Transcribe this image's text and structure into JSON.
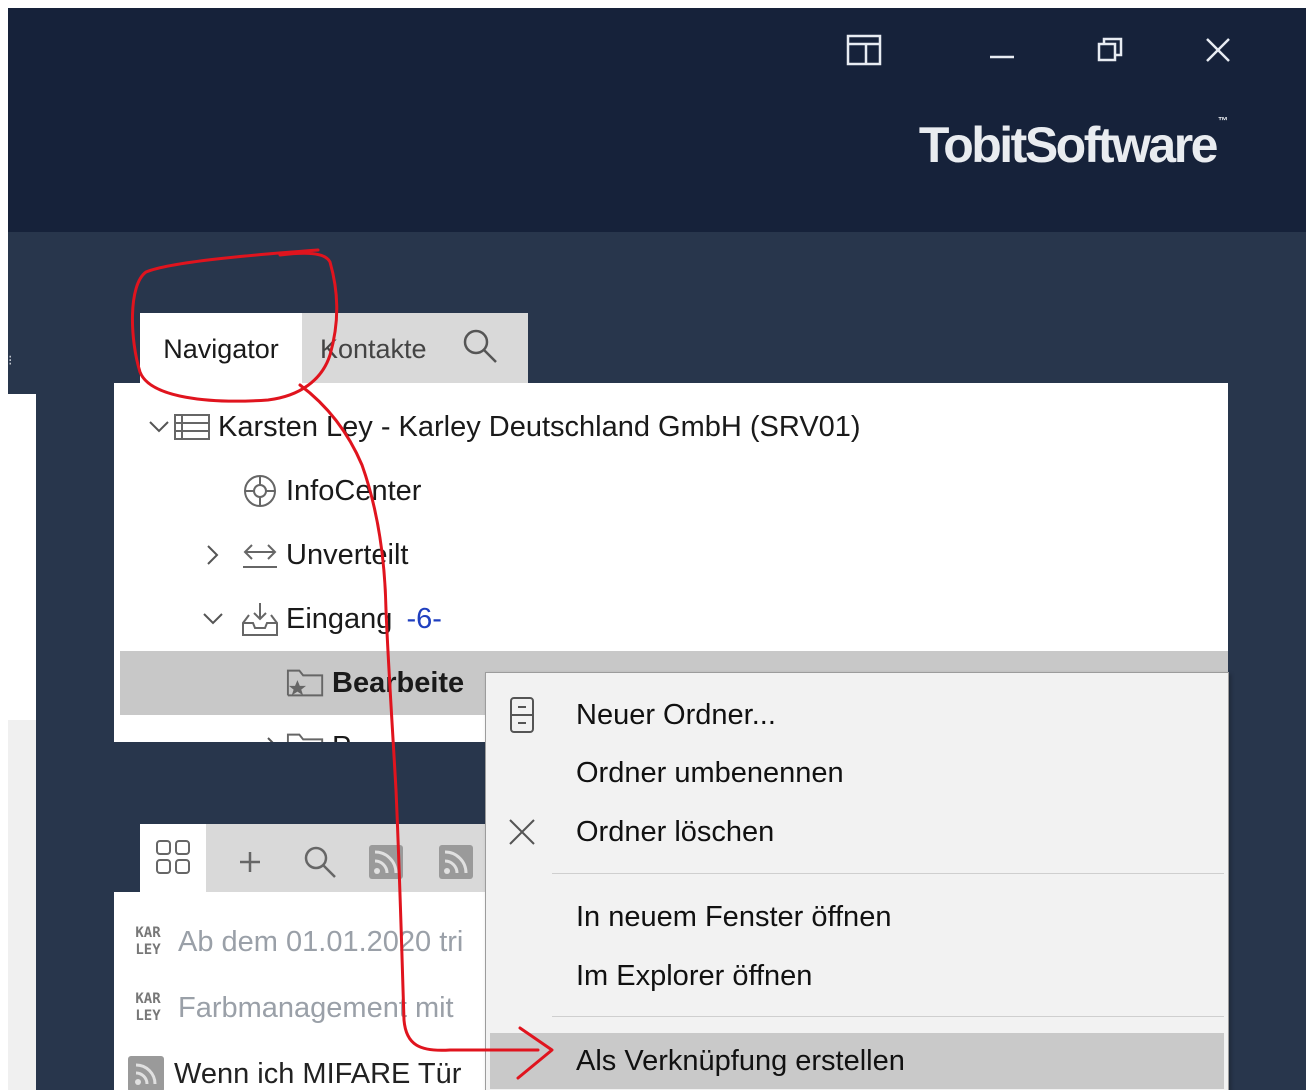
{
  "window": {
    "brand": "TobitSoftware",
    "brand_mark": "™"
  },
  "navigator": {
    "tabs": [
      {
        "label": "Navigator",
        "active": true
      },
      {
        "label": "Kontakte",
        "active": false
      }
    ],
    "tree": [
      {
        "label": "Karsten Ley - Karley Deutschland GmbH (SRV01)",
        "icon": "server-icon",
        "expanded": true
      },
      {
        "label": "InfoCenter",
        "icon": "infocenter-icon"
      },
      {
        "label": "Unverteilt",
        "icon": "unassigned-icon",
        "expanded": false
      },
      {
        "label": "Eingang",
        "icon": "inbox-icon",
        "expanded": true,
        "count": "-6-"
      },
      {
        "label": "Bearbeite",
        "icon": "folder-star-icon",
        "selected": true
      },
      {
        "label": "P",
        "icon": "folder-icon"
      }
    ]
  },
  "feed": {
    "items": [
      {
        "badge": [
          "KAR",
          "LEY"
        ],
        "text": "Ab dem 01.01.2020 tri"
      },
      {
        "badge": [
          "KAR",
          "LEY"
        ],
        "text": "Farbmanagement mit"
      },
      {
        "icon": "rss-icon",
        "text": "Wenn ich MIFARE Tür"
      }
    ]
  },
  "context_menu": {
    "items": [
      {
        "label": "Neuer Ordner...",
        "icon": "new-folder-icon"
      },
      {
        "label": "Ordner umbenennen"
      },
      {
        "label": "Ordner löschen",
        "icon": "delete-x-icon"
      },
      {
        "label": "In neuem Fenster öffnen"
      },
      {
        "label": "Im Explorer öffnen"
      },
      {
        "label": "Als Verknüpfung erstellen",
        "highlighted": true
      }
    ]
  },
  "colors": {
    "titlebar": "#16223a",
    "background": "#28364c",
    "annotation": "#e0141e",
    "selection": "#c8c8c8",
    "count": "#1f3fbf"
  }
}
